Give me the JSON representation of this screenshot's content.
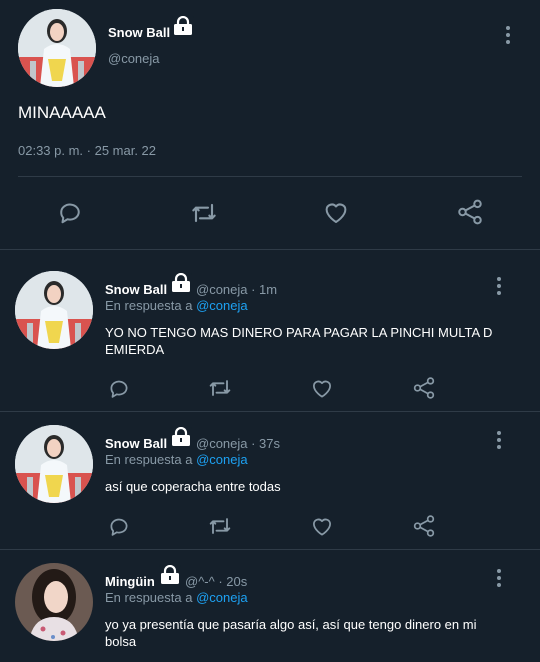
{
  "main": {
    "name": "Snow Ball",
    "handle": "@coneja",
    "text": "MINAAAAA",
    "timestamp": "02:33 p. m. · 25 mar. 22"
  },
  "replies": [
    {
      "name": "Snow Ball",
      "meta": "@coneja · 1m",
      "replying_label": "En respuesta a",
      "replying_to": "@coneja",
      "text": "YO NO TENGO MAS DINERO PARA PAGAR LA PINCHI MULTA D EMIERDA"
    },
    {
      "name": "Snow Ball",
      "meta": "@coneja · 37s",
      "replying_label": "En respuesta a",
      "replying_to": "@coneja",
      "text": "así que coperacha entre todas"
    },
    {
      "name": "Mingüin",
      "meta": "@^-^ · 20s",
      "replying_label": "En respuesta a",
      "replying_to": "@coneja",
      "text": "yo ya presentía que pasaría algo así, así que tengo dinero en mi bolsa"
    }
  ],
  "icons": [
    "reply-icon",
    "retweet-icon",
    "like-icon",
    "share-icon",
    "lock-icon",
    "more-icon"
  ],
  "colors": {
    "background": "#15202b",
    "secondary_text": "#8899a6",
    "link": "#1da1f2",
    "divider": "#2f3b47"
  }
}
